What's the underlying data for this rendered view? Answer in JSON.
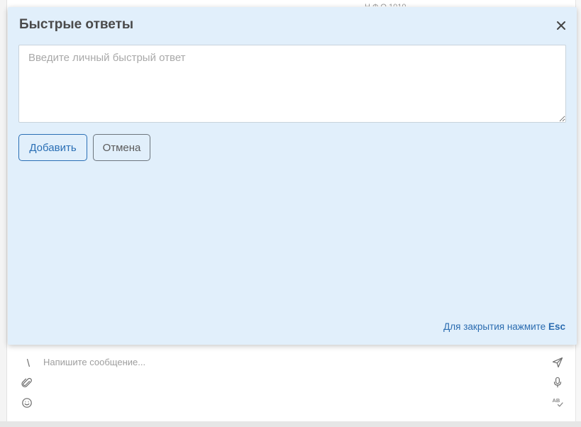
{
  "background": {
    "faded_text": "Н              Ф  О      1010"
  },
  "modal": {
    "title": "Быстрые ответы",
    "textarea_placeholder": "Введите личный быстрый ответ",
    "textarea_value": "",
    "add_label": "Добавить",
    "cancel_label": "Отмена",
    "close_hint_text": "Для закрытия нажмите",
    "close_hint_key": "Esc",
    "icons": {
      "close": "close-icon"
    }
  },
  "composer": {
    "slash": "\\",
    "placeholder": "Напишите сообщение...",
    "icons": {
      "left": [
        "slash-icon",
        "paperclip-icon",
        "smiley-icon"
      ],
      "right": [
        "send-icon",
        "microphone-icon",
        "spellcheck-icon"
      ]
    },
    "spellcheck_label": "AB"
  },
  "colors": {
    "modal_bg": "#e1effb",
    "accent": "#2a6fb5",
    "link": "#2b6cb0"
  }
}
